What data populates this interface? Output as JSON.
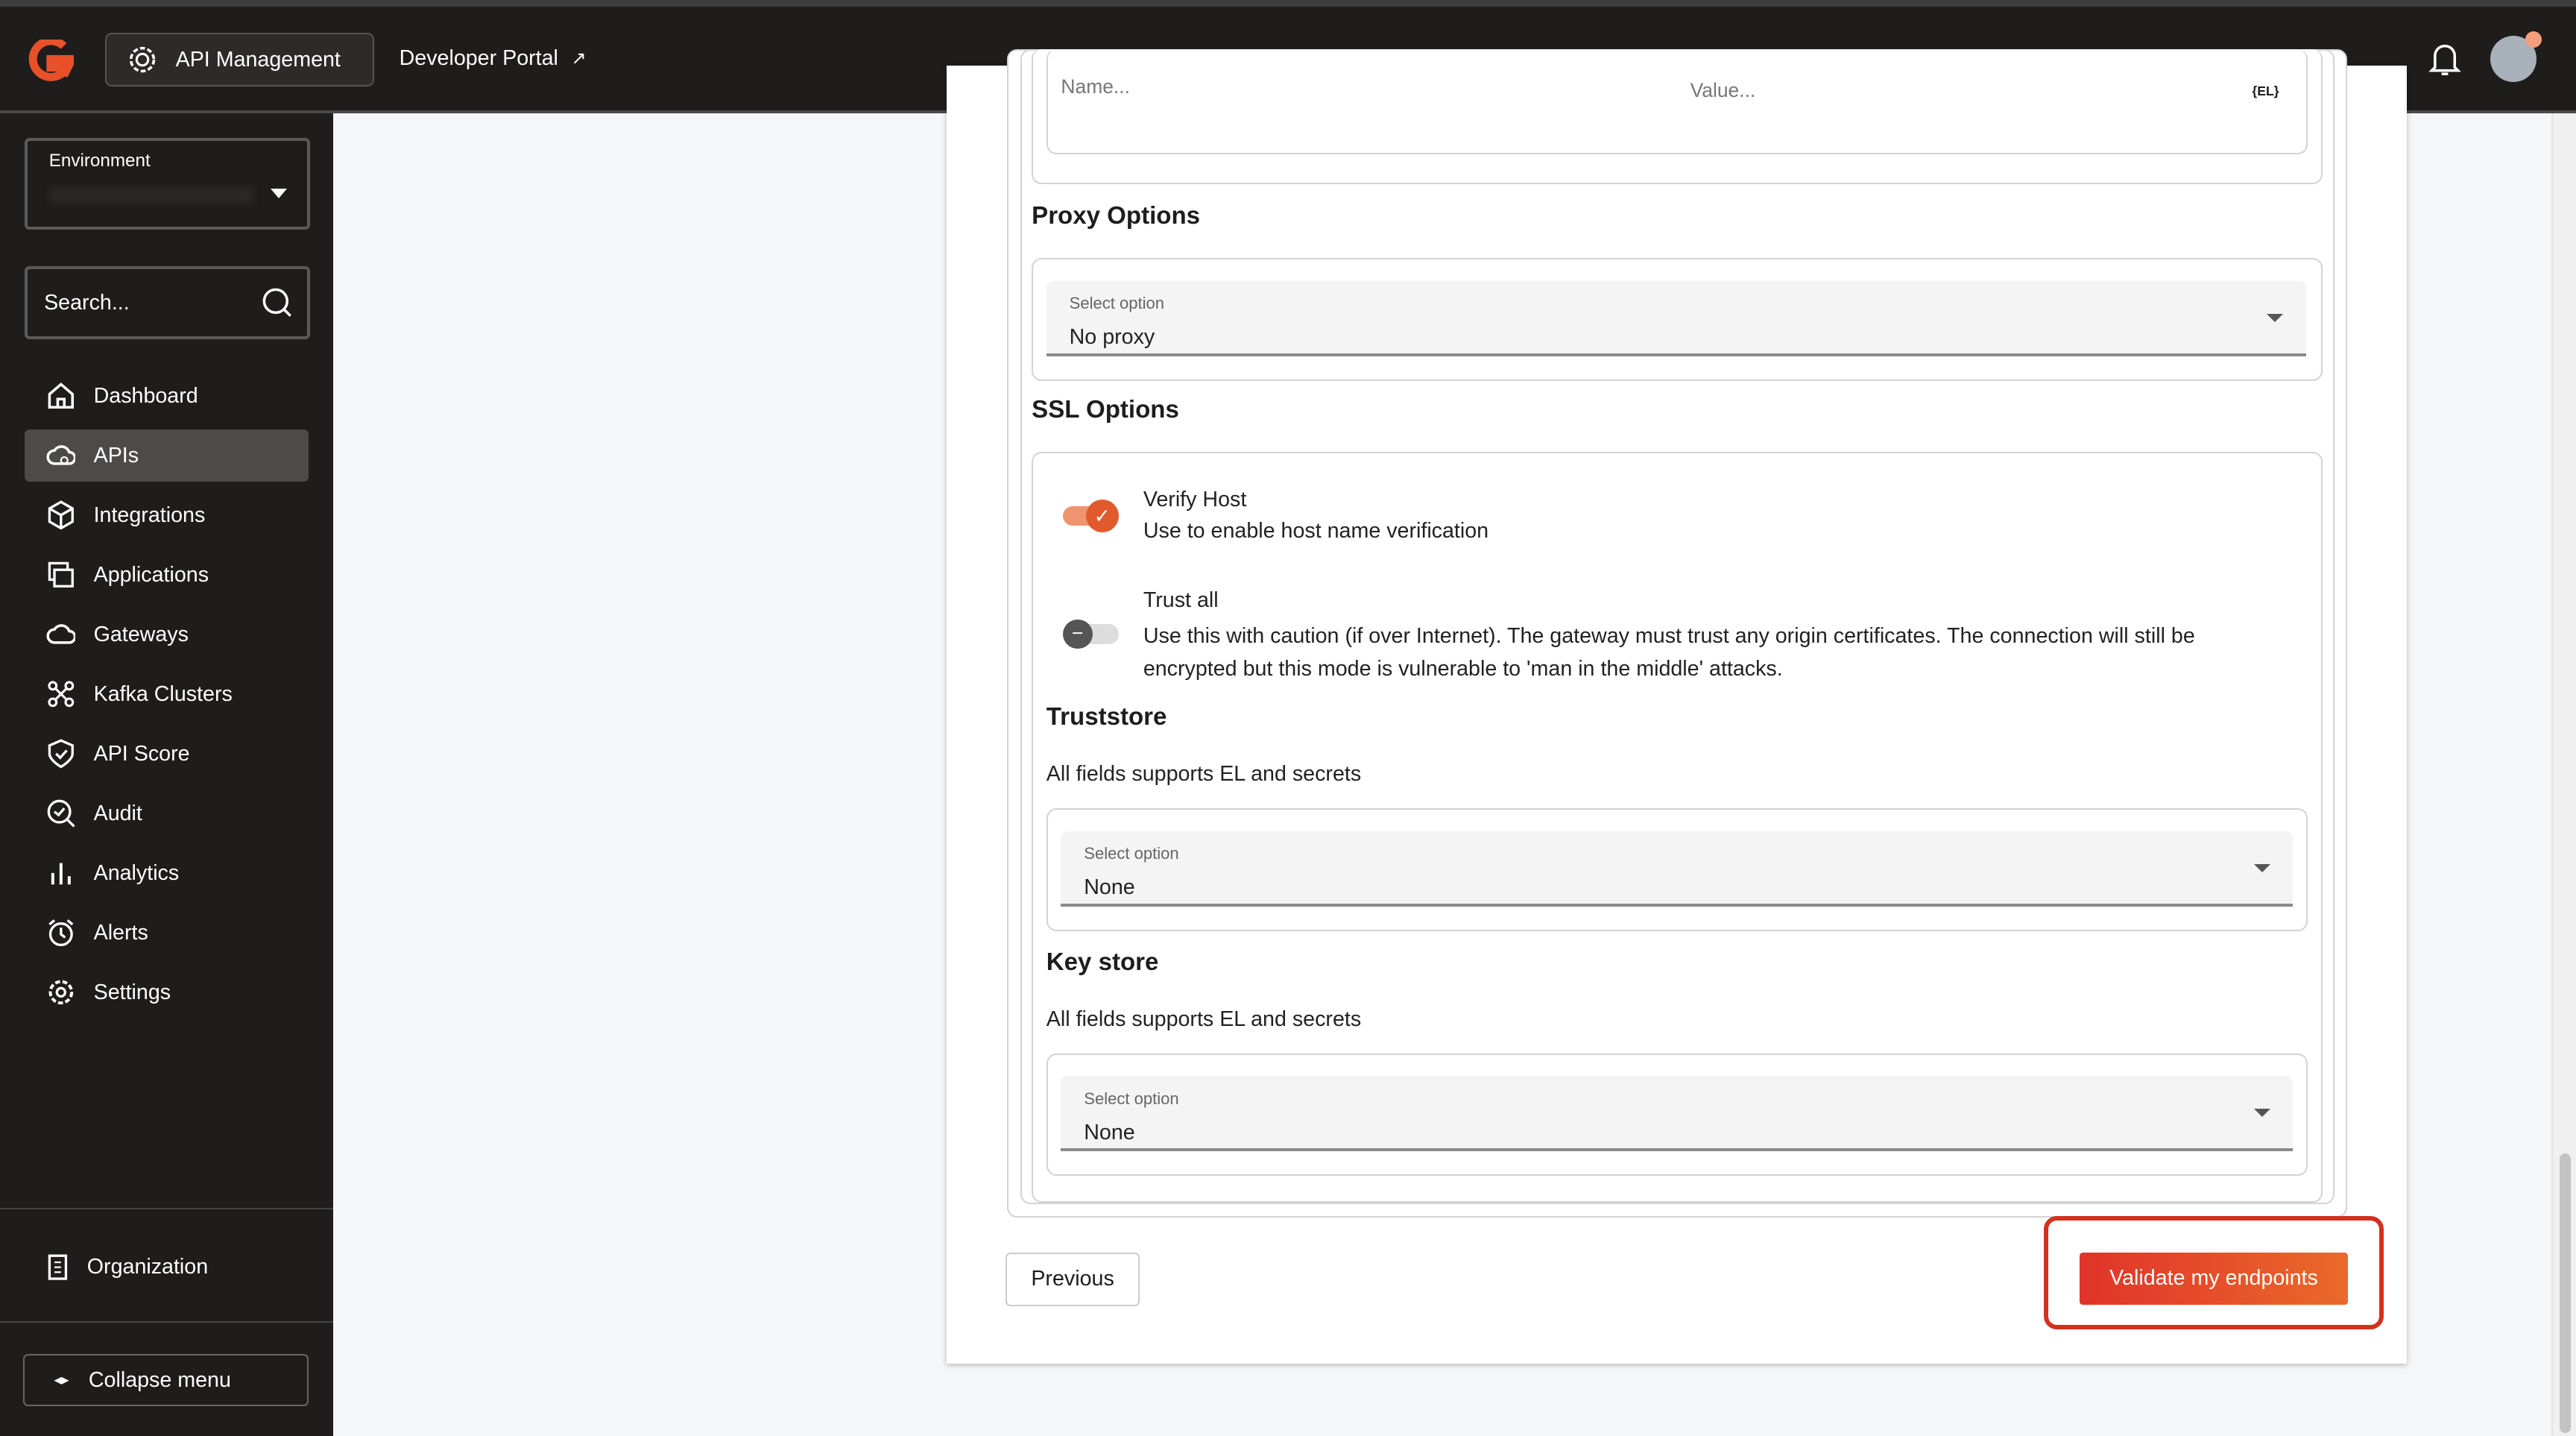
{
  "header": {
    "app_button": "API Management",
    "developer_portal": "Developer Portal"
  },
  "sidebar": {
    "environment_label": "Environment",
    "search_placeholder": "Search...",
    "items": [
      {
        "label": "Dashboard",
        "icon": "home-icon"
      },
      {
        "label": "APIs",
        "icon": "cloud-api-icon"
      },
      {
        "label": "Integrations",
        "icon": "cube-icon"
      },
      {
        "label": "Applications",
        "icon": "applications-icon"
      },
      {
        "label": "Gateways",
        "icon": "cloud-icon"
      },
      {
        "label": "Kafka Clusters",
        "icon": "cluster-icon"
      },
      {
        "label": "API Score",
        "icon": "shield-check-icon"
      },
      {
        "label": "Audit",
        "icon": "search-check-icon"
      },
      {
        "label": "Analytics",
        "icon": "bar-chart-icon"
      },
      {
        "label": "Alerts",
        "icon": "alarm-icon"
      },
      {
        "label": "Settings",
        "icon": "gear-icon"
      }
    ],
    "active_item": "APIs",
    "organization": "Organization",
    "collapse": "Collapse menu"
  },
  "form": {
    "header_row": {
      "name_placeholder": "Name...",
      "value_placeholder": "Value...",
      "el_badge": "{EL}"
    },
    "proxy": {
      "title": "Proxy Options",
      "select_label": "Select option",
      "value": "No proxy"
    },
    "ssl": {
      "title": "SSL Options",
      "verify_host": {
        "label": "Verify Host",
        "description": "Use to enable host name verification",
        "enabled": true
      },
      "trust_all": {
        "label": "Trust all",
        "description": "Use this with caution (if over Internet). The gateway must trust any origin certificates. The connection will still be encrypted but this mode is vulnerable to 'man in the middle' attacks.",
        "enabled": false
      }
    },
    "truststore": {
      "title": "Truststore",
      "hint": "All fields supports EL and secrets",
      "select_label": "Select option",
      "value": "None"
    },
    "keystore": {
      "title": "Key store",
      "hint": "All fields supports EL and secrets",
      "select_label": "Select option",
      "value": "None"
    }
  },
  "actions": {
    "previous": "Previous",
    "validate": "Validate my endpoints"
  },
  "colors": {
    "accent": "#e8582a",
    "validate_button": "#e0412a",
    "highlight_border": "#d3301f",
    "sidebar_bg": "#1f1c1c"
  }
}
